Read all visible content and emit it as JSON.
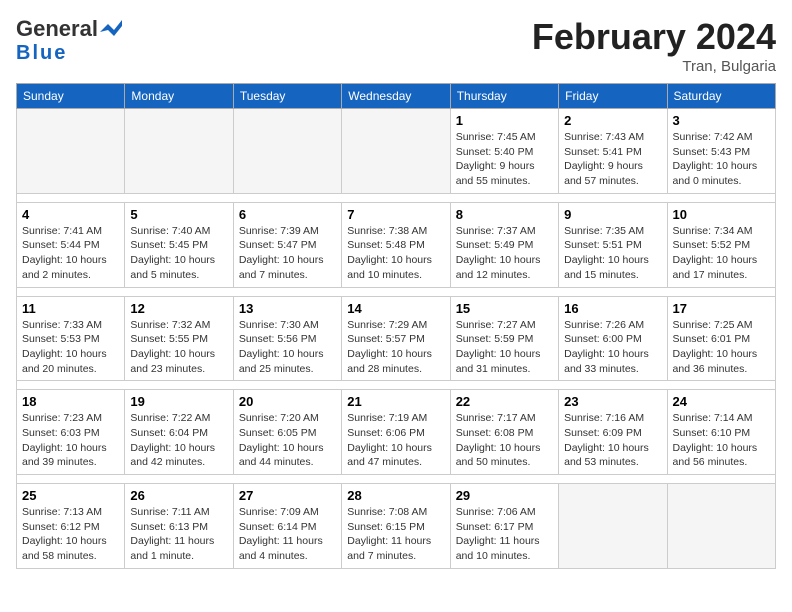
{
  "header": {
    "logo_general": "General",
    "logo_blue": "Blue",
    "title": "February 2024",
    "location": "Tran, Bulgaria"
  },
  "calendar": {
    "days_of_week": [
      "Sunday",
      "Monday",
      "Tuesday",
      "Wednesday",
      "Thursday",
      "Friday",
      "Saturday"
    ],
    "weeks": [
      [
        {
          "day": "",
          "info": ""
        },
        {
          "day": "",
          "info": ""
        },
        {
          "day": "",
          "info": ""
        },
        {
          "day": "",
          "info": ""
        },
        {
          "day": "1",
          "info": "Sunrise: 7:45 AM\nSunset: 5:40 PM\nDaylight: 9 hours\nand 55 minutes."
        },
        {
          "day": "2",
          "info": "Sunrise: 7:43 AM\nSunset: 5:41 PM\nDaylight: 9 hours\nand 57 minutes."
        },
        {
          "day": "3",
          "info": "Sunrise: 7:42 AM\nSunset: 5:43 PM\nDaylight: 10 hours\nand 0 minutes."
        }
      ],
      [
        {
          "day": "4",
          "info": "Sunrise: 7:41 AM\nSunset: 5:44 PM\nDaylight: 10 hours\nand 2 minutes."
        },
        {
          "day": "5",
          "info": "Sunrise: 7:40 AM\nSunset: 5:45 PM\nDaylight: 10 hours\nand 5 minutes."
        },
        {
          "day": "6",
          "info": "Sunrise: 7:39 AM\nSunset: 5:47 PM\nDaylight: 10 hours\nand 7 minutes."
        },
        {
          "day": "7",
          "info": "Sunrise: 7:38 AM\nSunset: 5:48 PM\nDaylight: 10 hours\nand 10 minutes."
        },
        {
          "day": "8",
          "info": "Sunrise: 7:37 AM\nSunset: 5:49 PM\nDaylight: 10 hours\nand 12 minutes."
        },
        {
          "day": "9",
          "info": "Sunrise: 7:35 AM\nSunset: 5:51 PM\nDaylight: 10 hours\nand 15 minutes."
        },
        {
          "day": "10",
          "info": "Sunrise: 7:34 AM\nSunset: 5:52 PM\nDaylight: 10 hours\nand 17 minutes."
        }
      ],
      [
        {
          "day": "11",
          "info": "Sunrise: 7:33 AM\nSunset: 5:53 PM\nDaylight: 10 hours\nand 20 minutes."
        },
        {
          "day": "12",
          "info": "Sunrise: 7:32 AM\nSunset: 5:55 PM\nDaylight: 10 hours\nand 23 minutes."
        },
        {
          "day": "13",
          "info": "Sunrise: 7:30 AM\nSunset: 5:56 PM\nDaylight: 10 hours\nand 25 minutes."
        },
        {
          "day": "14",
          "info": "Sunrise: 7:29 AM\nSunset: 5:57 PM\nDaylight: 10 hours\nand 28 minutes."
        },
        {
          "day": "15",
          "info": "Sunrise: 7:27 AM\nSunset: 5:59 PM\nDaylight: 10 hours\nand 31 minutes."
        },
        {
          "day": "16",
          "info": "Sunrise: 7:26 AM\nSunset: 6:00 PM\nDaylight: 10 hours\nand 33 minutes."
        },
        {
          "day": "17",
          "info": "Sunrise: 7:25 AM\nSunset: 6:01 PM\nDaylight: 10 hours\nand 36 minutes."
        }
      ],
      [
        {
          "day": "18",
          "info": "Sunrise: 7:23 AM\nSunset: 6:03 PM\nDaylight: 10 hours\nand 39 minutes."
        },
        {
          "day": "19",
          "info": "Sunrise: 7:22 AM\nSunset: 6:04 PM\nDaylight: 10 hours\nand 42 minutes."
        },
        {
          "day": "20",
          "info": "Sunrise: 7:20 AM\nSunset: 6:05 PM\nDaylight: 10 hours\nand 44 minutes."
        },
        {
          "day": "21",
          "info": "Sunrise: 7:19 AM\nSunset: 6:06 PM\nDaylight: 10 hours\nand 47 minutes."
        },
        {
          "day": "22",
          "info": "Sunrise: 7:17 AM\nSunset: 6:08 PM\nDaylight: 10 hours\nand 50 minutes."
        },
        {
          "day": "23",
          "info": "Sunrise: 7:16 AM\nSunset: 6:09 PM\nDaylight: 10 hours\nand 53 minutes."
        },
        {
          "day": "24",
          "info": "Sunrise: 7:14 AM\nSunset: 6:10 PM\nDaylight: 10 hours\nand 56 minutes."
        }
      ],
      [
        {
          "day": "25",
          "info": "Sunrise: 7:13 AM\nSunset: 6:12 PM\nDaylight: 10 hours\nand 58 minutes."
        },
        {
          "day": "26",
          "info": "Sunrise: 7:11 AM\nSunset: 6:13 PM\nDaylight: 11 hours\nand 1 minute."
        },
        {
          "day": "27",
          "info": "Sunrise: 7:09 AM\nSunset: 6:14 PM\nDaylight: 11 hours\nand 4 minutes."
        },
        {
          "day": "28",
          "info": "Sunrise: 7:08 AM\nSunset: 6:15 PM\nDaylight: 11 hours\nand 7 minutes."
        },
        {
          "day": "29",
          "info": "Sunrise: 7:06 AM\nSunset: 6:17 PM\nDaylight: 11 hours\nand 10 minutes."
        },
        {
          "day": "",
          "info": ""
        },
        {
          "day": "",
          "info": ""
        }
      ]
    ]
  }
}
